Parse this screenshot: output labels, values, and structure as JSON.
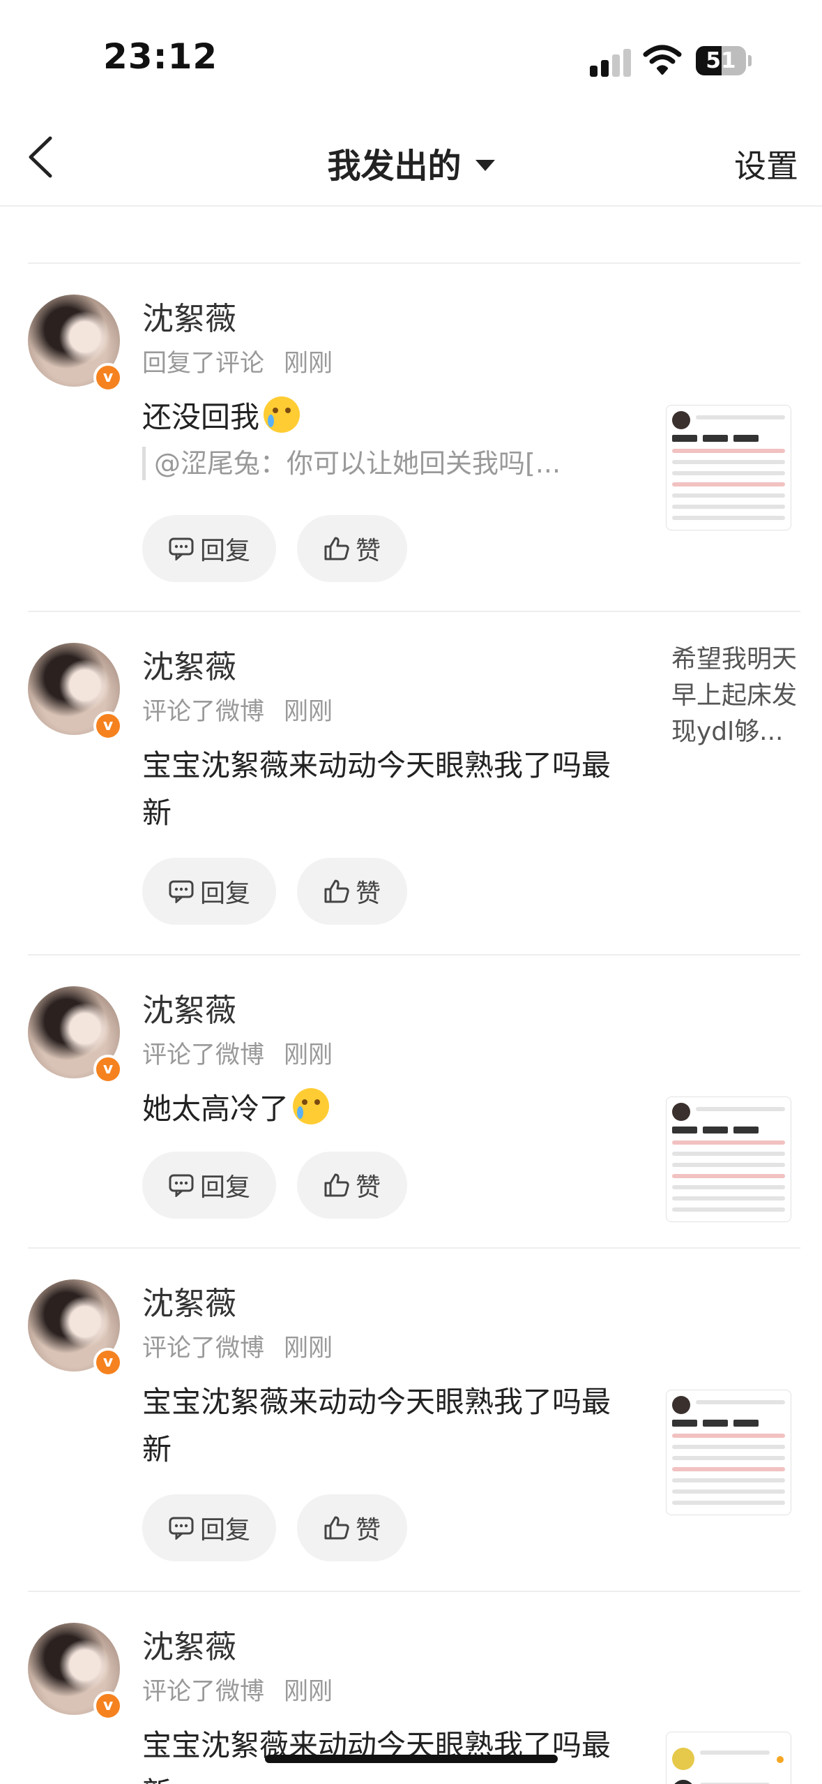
{
  "status_bar": {
    "time": "23:12",
    "battery": "51",
    "battery_level": 0.51
  },
  "nav": {
    "title": "我发出的",
    "settings": "设置"
  },
  "actions": {
    "reply": "回复",
    "like": "赞"
  },
  "items": [
    {
      "username": "沈絮薇",
      "action": "回复了评论",
      "time": "刚刚",
      "content": "还没回我",
      "quote": "@涩尾兔：你可以让她回关我吗[..."
    },
    {
      "username": "沈絮薇",
      "action": "评论了微博",
      "time": "刚刚",
      "content": "宝宝沈絮薇来动动今天眼熟我了吗最新",
      "snippet": "希望我明天早上起床发现ydl够..."
    },
    {
      "username": "沈絮薇",
      "action": "评论了微博",
      "time": "刚刚",
      "content": "她太高冷了"
    },
    {
      "username": "沈絮薇",
      "action": "评论了微博",
      "time": "刚刚",
      "content": "宝宝沈絮薇来动动今天眼熟我了吗最新"
    },
    {
      "username": "沈絮薇",
      "action": "评论了微博",
      "time": "刚刚",
      "content": "宝宝沈絮薇来动动今天眼熟我了吗最新"
    }
  ]
}
